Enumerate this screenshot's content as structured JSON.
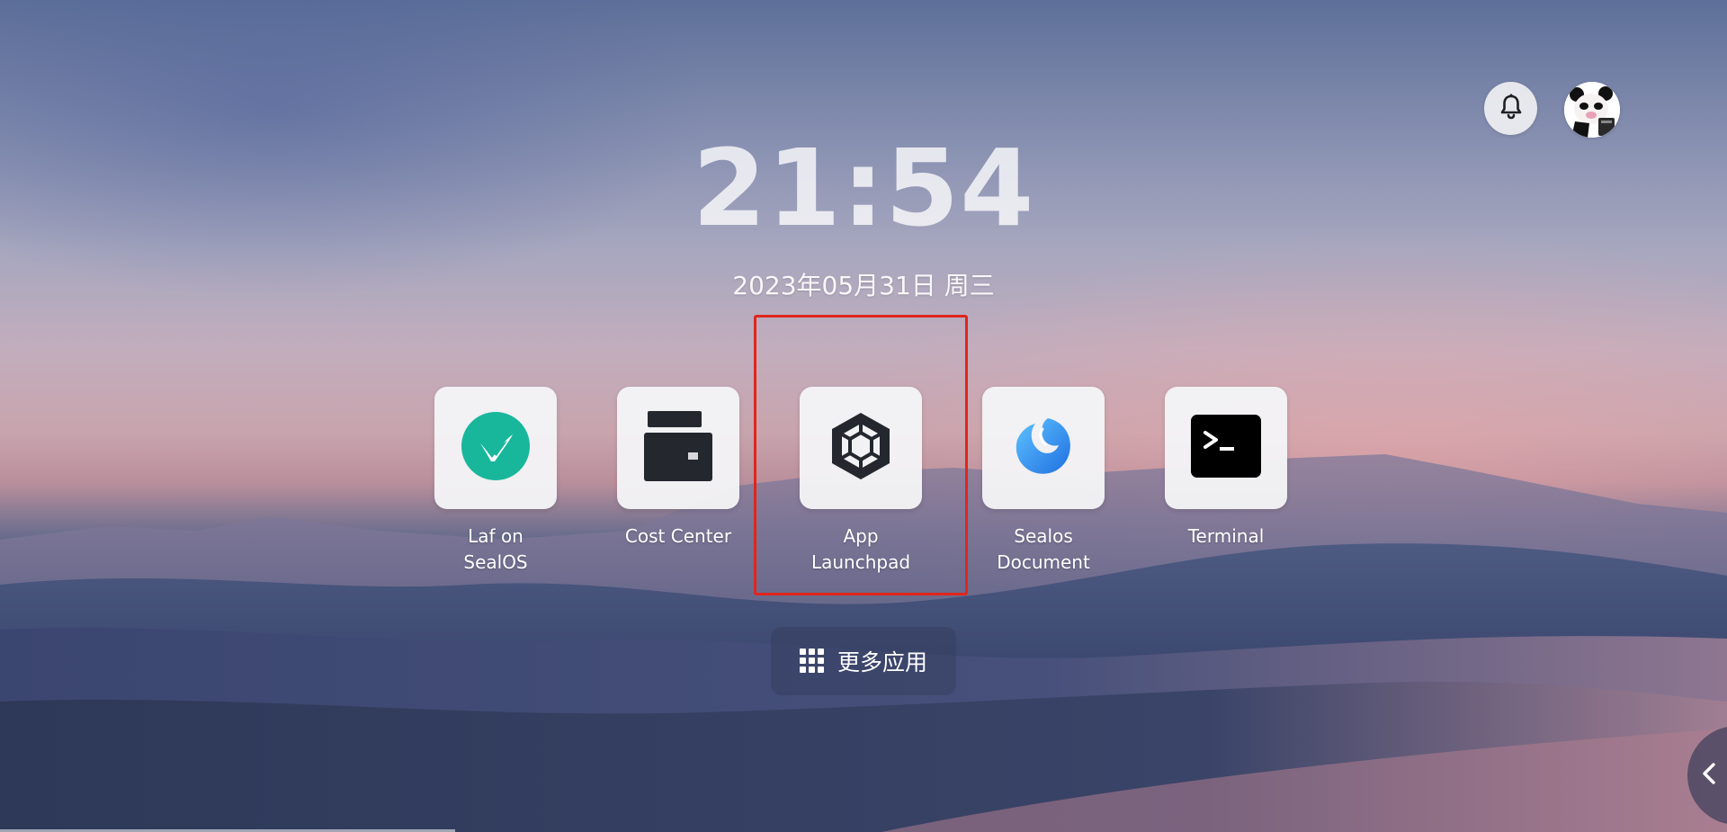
{
  "clock": {
    "time": "21:54",
    "date": "2023年05月31日 周三"
  },
  "apps": [
    {
      "label": "Laf on\nSealOS",
      "icon": "laf-icon"
    },
    {
      "label": "Cost Center",
      "icon": "wallet-icon"
    },
    {
      "label": "App\nLaunchpad",
      "icon": "hexagon-launchpad-icon"
    },
    {
      "label": "Sealos\nDocument",
      "icon": "sealos-document-icon"
    },
    {
      "label": "Terminal",
      "icon": "terminal-icon"
    }
  ],
  "more_apps": {
    "label": "更多应用",
    "icon": "grid-icon"
  },
  "header": {
    "notification_icon": "bell-icon",
    "avatar_icon": "panda-avatar-icon"
  },
  "sidebar_toggle": {
    "icon": "chevron-left-icon"
  },
  "colors": {
    "laf_green": "#18b79b",
    "highlight_red": "#e0261c",
    "terminal_black": "#000000",
    "wallet_dark": "#24272e",
    "doc_blue": "#2f8cf0"
  }
}
